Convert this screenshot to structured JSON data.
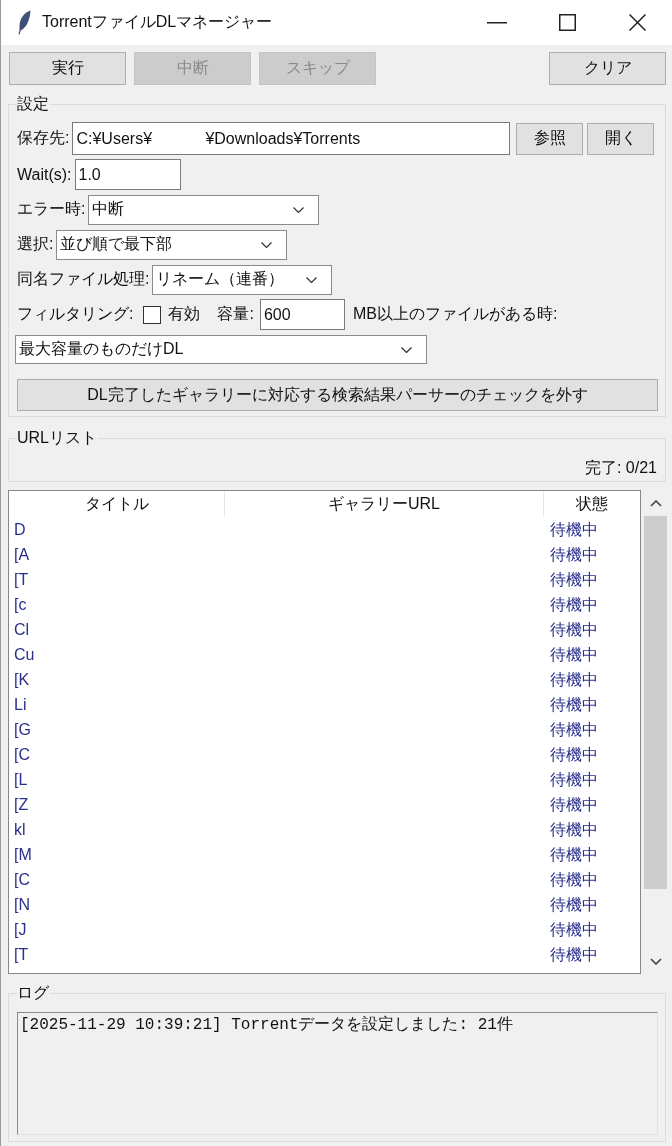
{
  "window": {
    "title": "TorrentファイルDLマネージャー"
  },
  "toolbar": [
    {
      "label": "実行",
      "disabled": false
    },
    {
      "label": "中断",
      "disabled": true
    },
    {
      "label": "スキップ",
      "disabled": true
    },
    {
      "label": "クリア",
      "disabled": false
    }
  ],
  "settings": {
    "title": "設定",
    "save_path": {
      "label": "保存先:",
      "value": "C:¥Users¥            ¥Downloads¥Torrents"
    },
    "path_buttons": [
      "参照",
      "開く"
    ],
    "wait": {
      "label": "Wait(s):",
      "value": "1.0"
    },
    "on_error": {
      "label": "エラー時:",
      "value": "中断"
    },
    "selection": {
      "label": "選択:",
      "value": "並び順で最下部"
    },
    "duplicate": {
      "label": "同名ファイル処理:",
      "value": "リネーム（連番）"
    },
    "filtering": {
      "label": "フィルタリング:",
      "enabled_label": "有効",
      "checked": false,
      "size_label": "容量:",
      "size_value": "600",
      "size_suffix": "MB以上のファイルがある時:"
    },
    "filter_action": {
      "value": "最大容量のものだけDL"
    },
    "uncheck_button": "DL完了したギャラリーに対応する検索結果パーサーのチェックを外す"
  },
  "url_list": {
    "title": "URLリスト",
    "progress": "完了: 0/21",
    "table": {
      "columns": [
        "タイトル",
        "ギャラリーURL",
        "状態"
      ],
      "rows": [
        {
          "title": "D",
          "status": "待機中"
        },
        {
          "title": "[A",
          "status": "待機中"
        },
        {
          "title": "[T",
          "status": "待機中"
        },
        {
          "title": "[c",
          "status": "待機中"
        },
        {
          "title": "Cl",
          "status": "待機中"
        },
        {
          "title": "Cu",
          "status": "待機中"
        },
        {
          "title": "[K",
          "status": "待機中"
        },
        {
          "title": "Li",
          "status": "待機中"
        },
        {
          "title": "[G",
          "status": "待機中"
        },
        {
          "title": "[C",
          "status": "待機中"
        },
        {
          "title": "[L",
          "status": "待機中"
        },
        {
          "title": "[Z",
          "status": "待機中"
        },
        {
          "title": "kl",
          "status": "待機中"
        },
        {
          "title": "[M",
          "status": "待機中"
        },
        {
          "title": "[C",
          "status": "待機中"
        },
        {
          "title": "[N",
          "status": "待機中"
        },
        {
          "title": "[J",
          "status": "待機中"
        },
        {
          "title": "[T",
          "status": "待機中"
        }
      ]
    }
  },
  "log": {
    "title": "ログ",
    "lines": [
      "[2025-11-29 10:39:21] Torrentデータを設定しました: 21件"
    ]
  }
}
